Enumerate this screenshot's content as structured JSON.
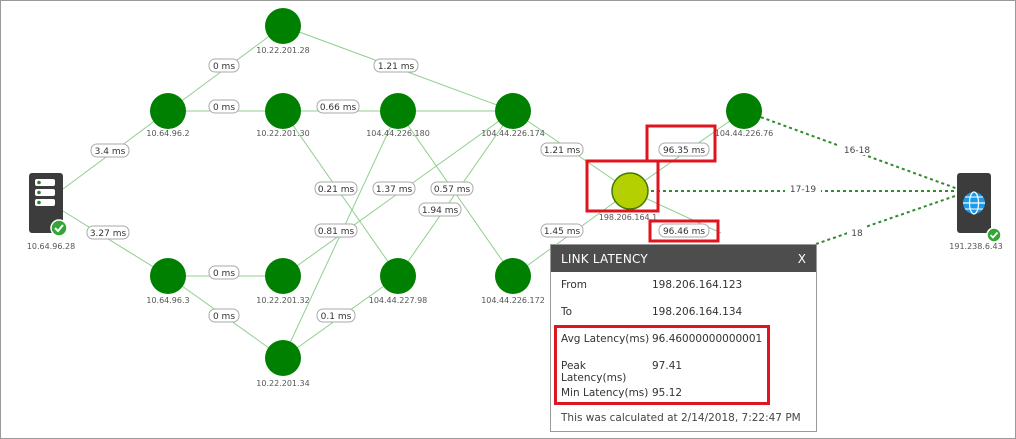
{
  "nodes": {
    "src": "10.64.96.28",
    "n1": "10.64.96.2",
    "n2": "10.64.96.3",
    "n3": "10.22.201.28",
    "n4": "10.22.201.30",
    "n5": "10.22.201.32",
    "n6": "10.22.201.34",
    "n7": "104.44.226.180",
    "n8": "104.44.227.98",
    "n9": "104.44.226.174",
    "n10": "104.44.226.172",
    "n11": "198.206.164.1",
    "n12": "104.44.226.76",
    "dst": "191.238.6.43"
  },
  "edge_labels": {
    "e1": "3.4 ms",
    "e2": "3.27 ms",
    "e3": "0 ms",
    "e4": "0 ms",
    "e5": "0 ms",
    "e6": "0 ms",
    "e7": "1.21 ms",
    "e8": "0.66 ms",
    "e9": "0.21 ms",
    "e10": "0.81 ms",
    "e11": "1.37 ms",
    "e12": "0.57 ms",
    "e13": "1.94 ms",
    "e14": "0.1 ms",
    "e15": "1.21 ms",
    "e16": "1.45 ms",
    "e17": "96.35 ms",
    "e18": "96.46 ms"
  },
  "dashed_labels": {
    "d1": "16-18",
    "d2": "17-19",
    "d3": "18"
  },
  "tooltip": {
    "title": "LINK LATENCY",
    "close": "X",
    "from_label": "From",
    "from_value": "198.206.164.123",
    "to_label": "To",
    "to_value": "198.206.164.134",
    "avg_label": "Avg Latency(ms)",
    "avg_value": "96.46000000000001",
    "peak_label": "Peak Latency(ms)",
    "peak_value": "97.41",
    "min_label": "Min Latency(ms)",
    "min_value": "95.12",
    "footer": "This was calculated at 2/14/2018, 7:22:47 PM"
  },
  "colors": {
    "node_green": "#008000",
    "node_selected": "#b5d000",
    "edge": "#8fcf8f",
    "dashed": "#2e8b2e",
    "highlight": "#e0141e",
    "check_green": "#34a634"
  },
  "icons": {
    "source": "server-icon",
    "destination": "globe-icon",
    "status": "checkmark-icon"
  }
}
